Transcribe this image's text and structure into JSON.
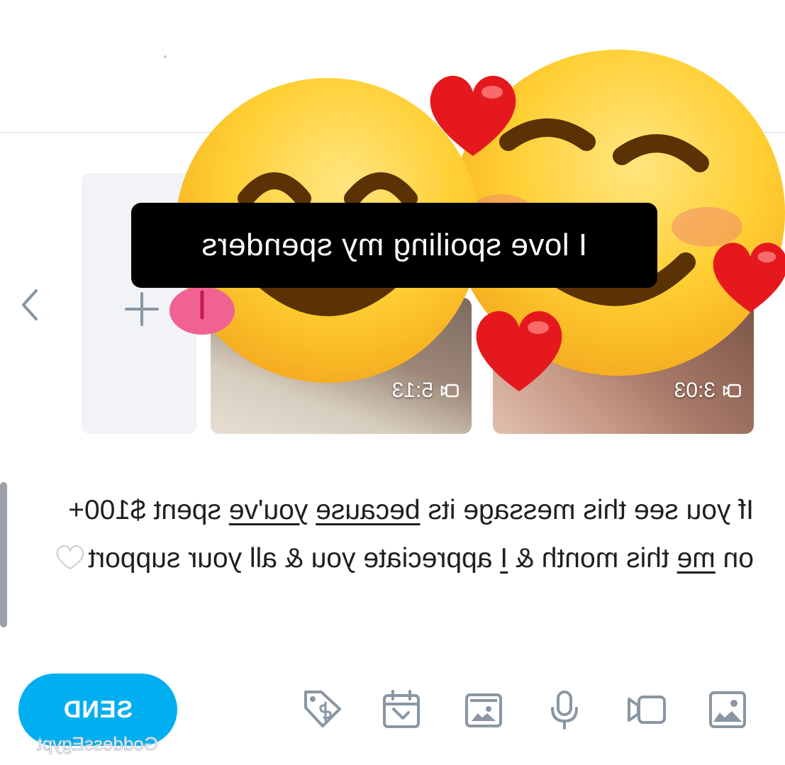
{
  "attachments": [
    {
      "duration": "3:03",
      "icon": "video-camera-icon"
    },
    {
      "duration": "5:13",
      "icon": "video-camera-icon"
    }
  ],
  "add_media_icon": "plus-icon",
  "next_icon": "chevron-right-icon",
  "overlay_caption": "I love spoiling my spenders",
  "message": {
    "segments": [
      {
        "text": "If you see this message its ",
        "u": false
      },
      {
        "text": "because",
        "u": true
      },
      {
        "text": " ",
        "u": false
      },
      {
        "text": "you've",
        "u": true
      },
      {
        "text": " spent $100+ on ",
        "u": false
      },
      {
        "text": "me",
        "u": true
      },
      {
        "text": " this month & ",
        "u": false
      },
      {
        "text": "I",
        "u": true
      },
      {
        "text": " appreciate you & all your support",
        "u": false
      }
    ],
    "trailing_emoji": "white-heart"
  },
  "toolbar": {
    "icons": [
      "image-icon",
      "video-icon",
      "microphone-icon",
      "vault-icon",
      "schedule-icon",
      "price-tag-icon"
    ],
    "send_label": "SEND"
  },
  "watermark": "GoddessEgypt",
  "colors": {
    "accent": "#00aff0",
    "icon_gray": "#8a96a3",
    "banner_bg": "#000000"
  }
}
